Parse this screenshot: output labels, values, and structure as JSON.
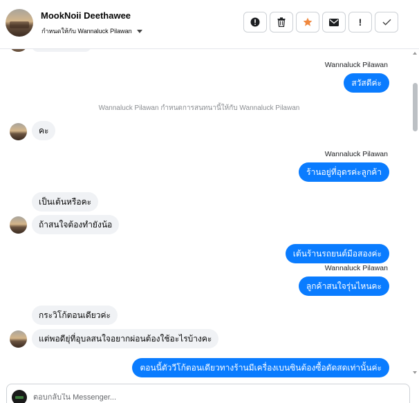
{
  "header": {
    "contact_name": "MookNoii Deethawee",
    "assigned_text": "กำหนดให้กับ Wannaluck Pilawan"
  },
  "toolbar": {
    "buttons": [
      {
        "icon": "alert-circle-icon"
      },
      {
        "icon": "trash-icon"
      },
      {
        "icon": "star-icon",
        "color": "#f0883e"
      },
      {
        "icon": "envelope-icon"
      },
      {
        "icon": "exclamation-icon",
        "glyph": "!"
      },
      {
        "icon": "check-icon"
      }
    ]
  },
  "messages": {
    "m1_sender": "Wannaluck Pilawan",
    "m1_text": "สวัสดีค่ะ",
    "system_note": "Wannaluck Pilawan กำหนดการสนทนานี้ให้กับ Wannaluck Pilawan",
    "m2_text": "คะ",
    "m3_sender": "Wannaluck Pilawan",
    "m3_text": "ร้านอยู่ที่อุดรค่ะลูกค้า",
    "m4_text": "เป็นเต้นหรือคะ",
    "m5_text": "ถ้าสนใจต้องทำยังน้อ",
    "m6_text": "เต้นร้านรถยนต์มือสองค่ะ",
    "m7_sender": "Wannaluck Pilawan",
    "m7_text": "ลูกค้าสนใจรุ่นไหนคะ",
    "m8_text": "กระวิโก้ตอนเดียวค่ะ",
    "m9_text": "แต่พอดียุ่ที่อุบลสนใจอยากผ่อนต้องใช้อะไรบ้างคะ",
    "m10_text": "ตอนนี้ตัววีโก้ตอนเดียวทางร้านมีเครื่องเบนซินต้องซื้อตัดสดเท่านั้นค่ะ"
  },
  "composer": {
    "placeholder": "ตอบกลับใน Messenger..."
  },
  "colors": {
    "outgoing_bubble": "#0a7cff",
    "incoming_bubble": "#f0f2f5",
    "accent_star": "#f0883e"
  }
}
